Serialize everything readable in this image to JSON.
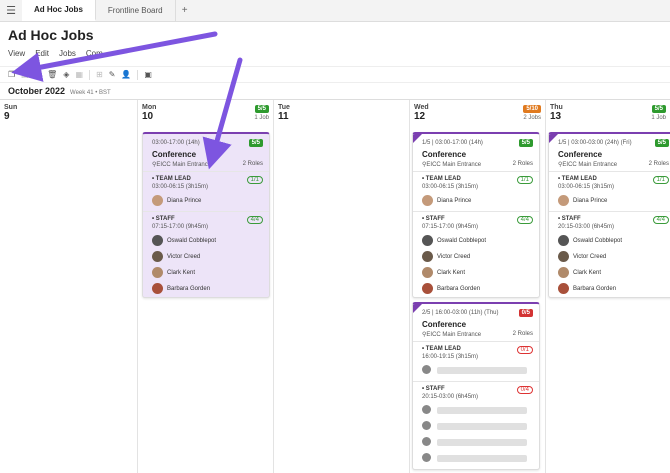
{
  "tabs": [
    {
      "label": "Ad Hoc Jobs",
      "active": true
    },
    {
      "label": "Frontline Board",
      "active": false
    }
  ],
  "page_title": "Ad Hoc Jobs",
  "menu": [
    "View",
    "Edit",
    "Jobs",
    "Com"
  ],
  "month": "October 2022",
  "week": "Week 41 • BST",
  "days": [
    {
      "name": "Sun",
      "num": "9"
    },
    {
      "name": "Mon",
      "num": "10",
      "badge": "5/5",
      "badge_color": "#2e9a2e",
      "jobs": "1 Job"
    },
    {
      "name": "Tue",
      "num": "11"
    },
    {
      "name": "Wed",
      "num": "12",
      "badge": "5/10",
      "badge_color": "#e07a1f",
      "jobs": "2 Jobs"
    },
    {
      "name": "Thu",
      "num": "13",
      "badge": "5/5",
      "badge_color": "#2e9a2e",
      "jobs": "1 Job"
    }
  ],
  "cards": {
    "mon": {
      "time": "03:00-17:00 (14h)",
      "badge": "5/5",
      "name": "Conference",
      "location": "EICC Main Entrance",
      "roles": "2 Roles",
      "lead": {
        "title": "TEAM LEAD",
        "time": "03:00-06:15 (3h15m)",
        "count": "1/1",
        "people": [
          "Diana Prince"
        ]
      },
      "staff": {
        "title": "STAFF",
        "time": "07:15-17:00 (9h45m)",
        "count": "4/4",
        "people": [
          "Oswald Cobblepot",
          "Victor Creed",
          "Clark Kent",
          "Barbara Gorden"
        ]
      }
    },
    "wed1": {
      "time": "1/5 | 03:00-17:00 (14h)",
      "badge": "5/5",
      "name": "Conference",
      "location": "EICC Main Entrance",
      "roles": "2 Roles",
      "lead": {
        "title": "TEAM LEAD",
        "time": "03:00-06:15 (3h15m)",
        "count": "1/1",
        "people": [
          "Diana Prince"
        ]
      },
      "staff": {
        "title": "STAFF",
        "time": "07:15-17:00 (9h45m)",
        "count": "4/4",
        "people": [
          "Oswald Cobblepot",
          "Victor Creed",
          "Clark Kent",
          "Barbara Gorden"
        ]
      }
    },
    "wed2": {
      "time": "2/5 | 16:00-03:00 (11h) (Thu)",
      "badge": "0/5",
      "name": "Conference",
      "location": "EICC Main Entrance",
      "roles": "2 Roles",
      "lead": {
        "title": "TEAM LEAD",
        "time": "16:00-19:15 (3h15m)",
        "count": "0/1"
      },
      "staff": {
        "title": "STAFF",
        "time": "20:15-03:00 (6h45m)",
        "count": "0/4"
      }
    },
    "thu": {
      "time": "1/5 | 03:00-03:00 (24h) (Fri)",
      "badge": "5/5",
      "name": "Conference",
      "location": "EICC Main Entrance",
      "roles": "2 Roles",
      "lead": {
        "title": "TEAM LEAD",
        "time": "03:00-06:15 (3h15m)",
        "count": "1/1",
        "people": [
          "Diana Prince"
        ]
      },
      "staff": {
        "title": "STAFF",
        "time": "20:15-03:00 (6h45m)",
        "count": "4/4",
        "people": [
          "Oswald Cobblepot",
          "Victor Creed",
          "Clark Kent",
          "Barbara Gorden"
        ]
      }
    }
  },
  "colors": {
    "accent": "#7b3fb0",
    "green": "#2e9a2e",
    "orange": "#e07a1f",
    "red": "#d33333",
    "arrow": "#7d55e0"
  },
  "icons": [
    "hamburger-icon",
    "copy-icon",
    "trash-icon",
    "layers-icon",
    "pencil-icon",
    "user-icon",
    "calendar-icon",
    "location-pin-icon"
  ]
}
